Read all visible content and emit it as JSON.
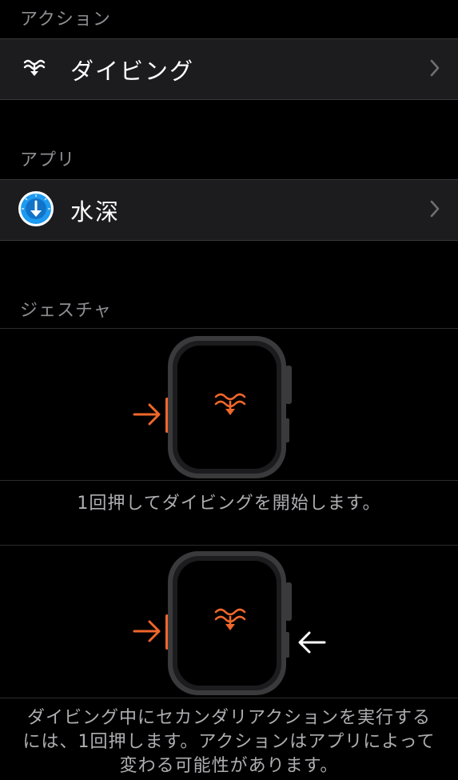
{
  "sections": {
    "action_header": "アクション",
    "app_header": "アプリ",
    "gesture_header": "ジェスチャ"
  },
  "action_row": {
    "label": "ダイビング",
    "icon": "dive-waves-icon"
  },
  "app_row": {
    "label": "水深",
    "icon": "depth-app-icon"
  },
  "gestures": [
    {
      "illustration": "watch-press-action-button",
      "caption": "1回押してダイビングを開始します。"
    },
    {
      "illustration": "watch-press-action-and-side-button",
      "caption_lines": [
        "ダイビング中にセカンダリアクションを実行する",
        "には、1回押します。アクションはアプリによって",
        "変わる可能性があります。"
      ]
    }
  ],
  "colors": {
    "accent_orange": "#f0672a",
    "row_background": "#1c1c1e",
    "secondary_text": "#8e8e93",
    "app_icon_blue": "#1e9bf0"
  }
}
